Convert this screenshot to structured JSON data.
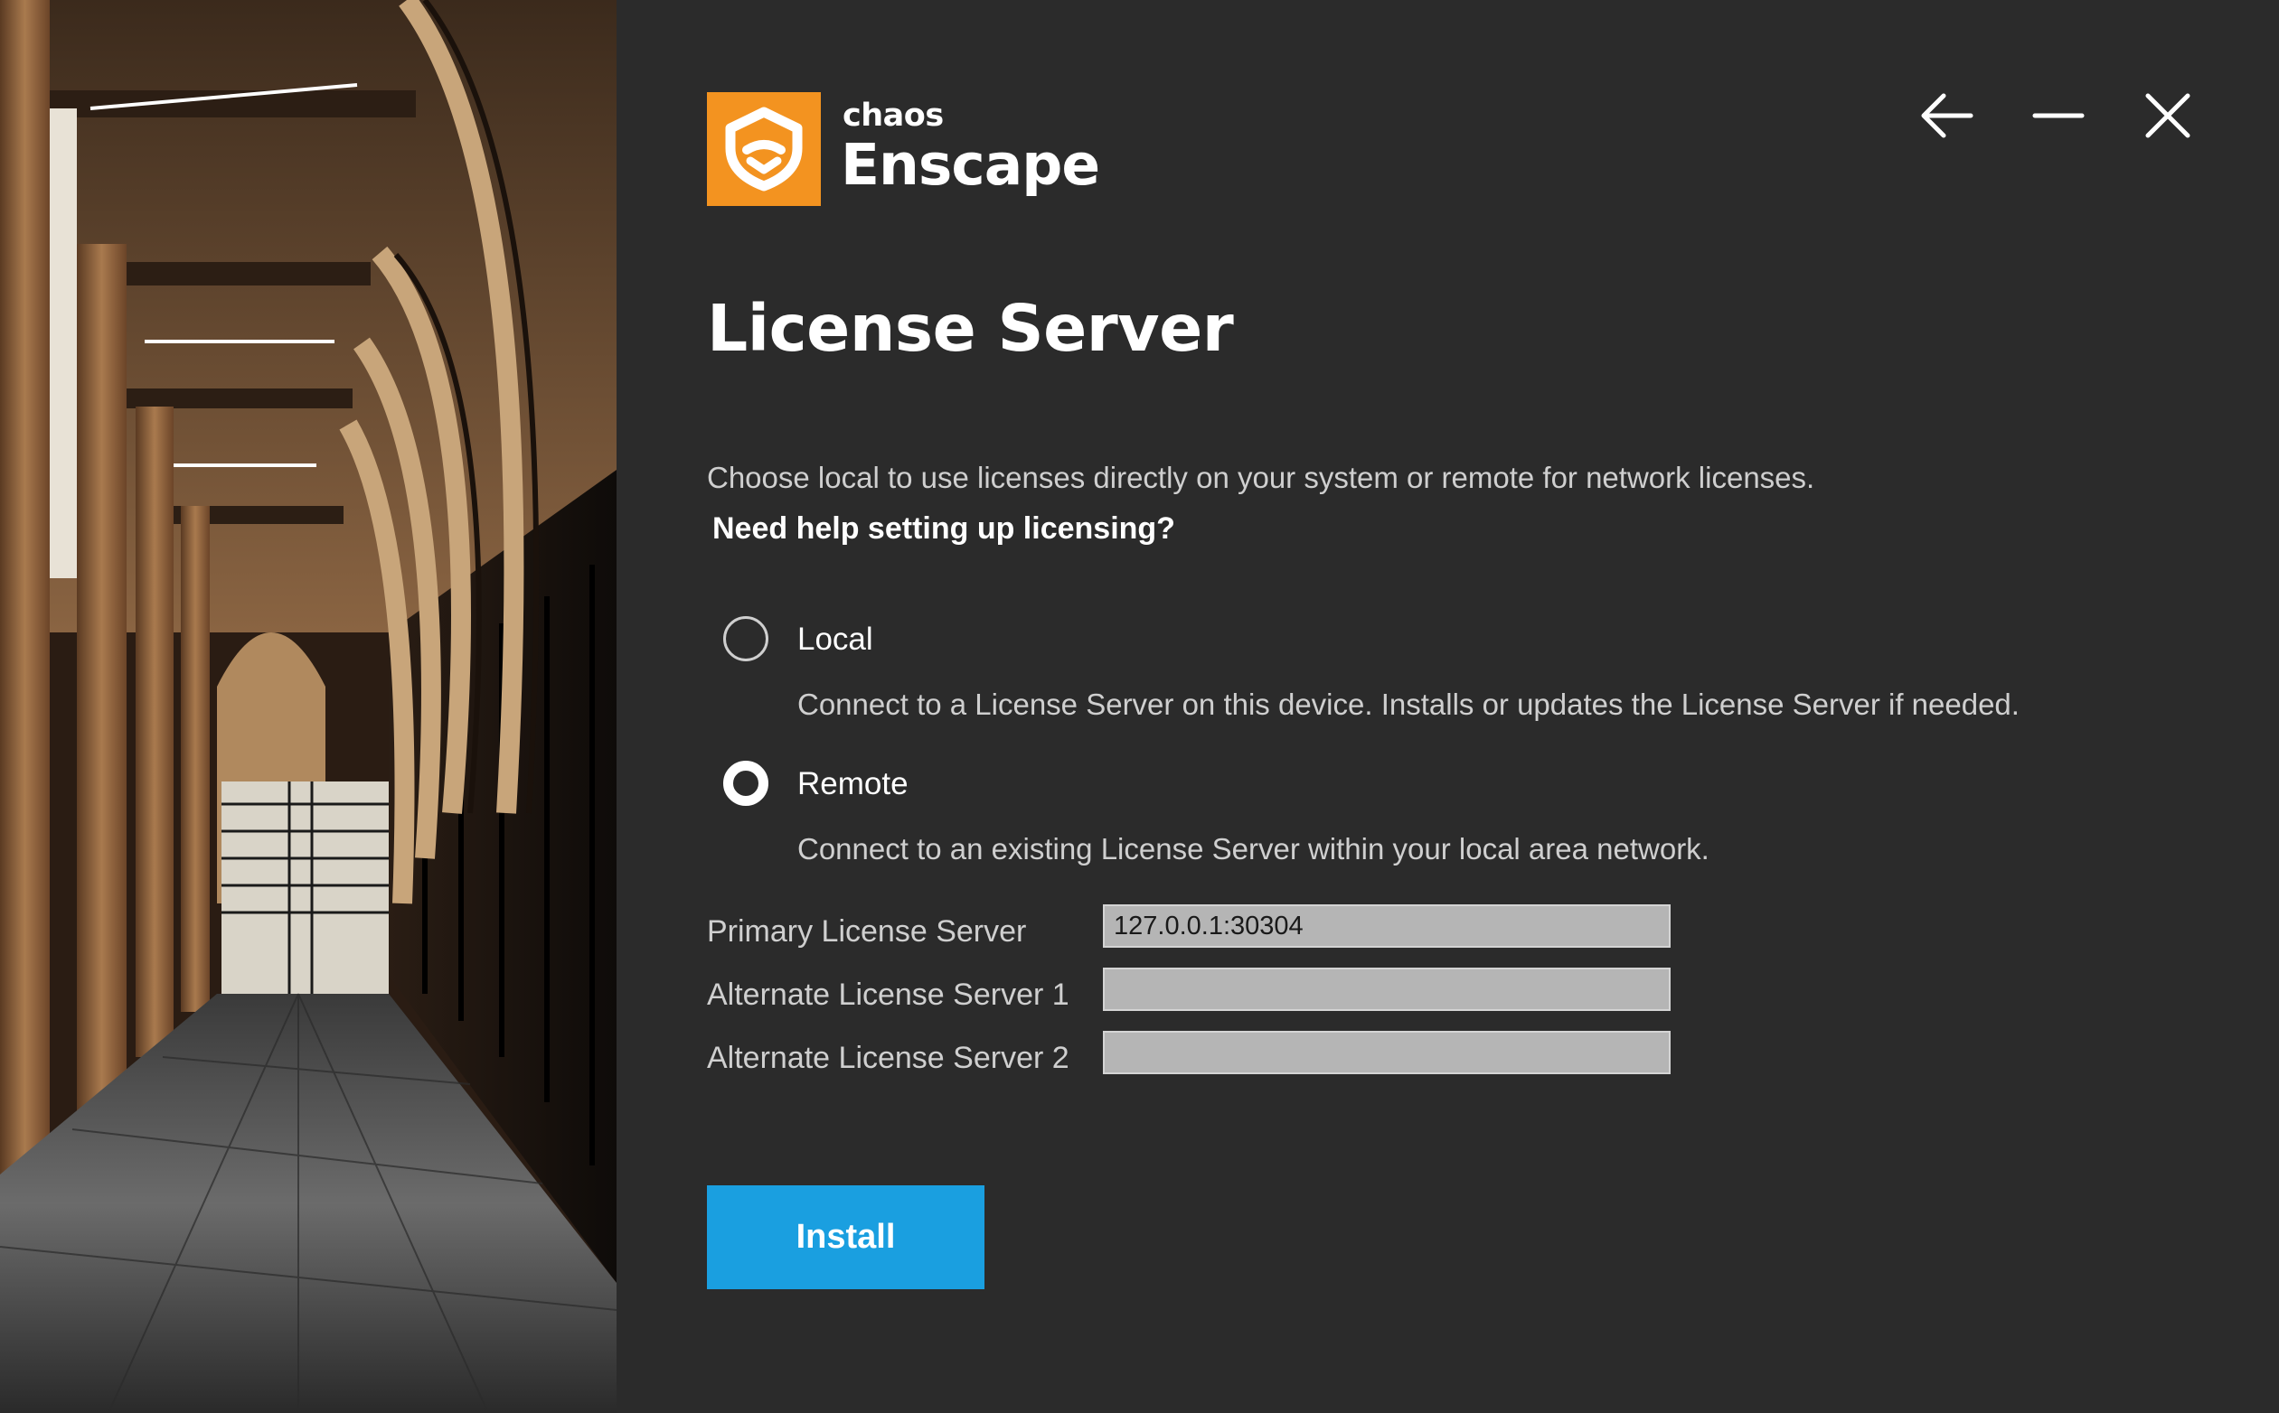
{
  "window": {
    "controls": {
      "back_icon": "arrow-left-icon",
      "minimize_icon": "minimize-icon",
      "close_icon": "close-icon"
    }
  },
  "logo": {
    "brand": "chaos",
    "product": "Enscape",
    "icon": "enscape-logo-icon",
    "accent_color": "#f39320"
  },
  "page": {
    "title": "License Server",
    "description": "Choose local to use licenses directly on your system or remote for network licenses.",
    "help_link": "Need help setting up licensing?"
  },
  "options": [
    {
      "label": "Local",
      "description": "Connect to a License Server on this device. Installs or updates the License Server if needed.",
      "selected": false
    },
    {
      "label": "Remote",
      "description": "Connect to an existing License Server within your local area network.",
      "selected": true
    }
  ],
  "servers": [
    {
      "label": "Primary License Server",
      "value": "127.0.0.1:30304"
    },
    {
      "label": "Alternate License Server 1",
      "value": ""
    },
    {
      "label": "Alternate License Server 2",
      "value": ""
    }
  ],
  "install_button": {
    "label": "Install",
    "color": "#1a9fe0"
  },
  "colors": {
    "background": "#2b2b2b",
    "text_primary": "#ffffff",
    "text_secondary": "#cfcfcf"
  }
}
